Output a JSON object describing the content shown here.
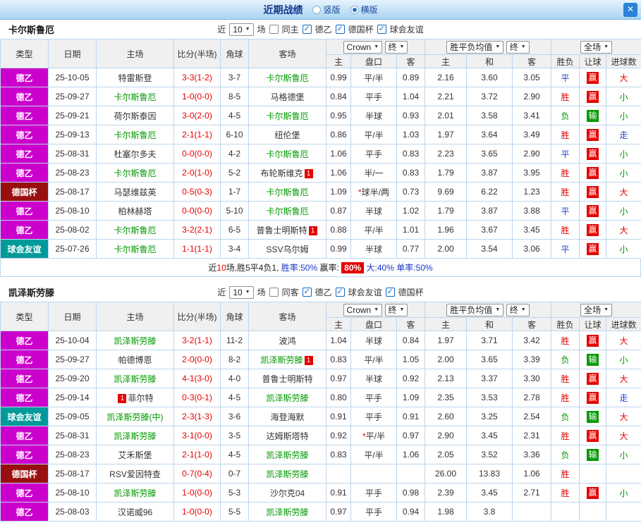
{
  "topbar": {
    "title": "近期战绩",
    "mode_vertical": "竖版",
    "mode_horizontal": "横版",
    "selected_mode": "横版",
    "close_label": "✕"
  },
  "header": {
    "type": "类型",
    "date": "日期",
    "home": "主场",
    "score": "比分(半场)",
    "corner": "角球",
    "away": "客场",
    "odds_company": "Crown",
    "odds_time": "终",
    "avg": "胜平负均值",
    "avg_time": "终",
    "scope": "全场",
    "sub_home": "主",
    "sub_handicap": "盘口",
    "sub_away": "客",
    "sub_avg_home": "主",
    "sub_avg_draw": "和",
    "sub_avg_away": "客",
    "sub_result": "胜负",
    "sub_let": "让球",
    "sub_goals": "进球数"
  },
  "colors": {
    "league2_badge": "#cc00cc",
    "cup_badge": "#990f0f",
    "friendly_badge": "#009a9a",
    "team_highlight": "#009900",
    "win_red": "#e60000",
    "draw_blue": "#2244cc",
    "lose_green": "#009900"
  },
  "sections": [
    {
      "team": "卡尔斯鲁厄",
      "filter": {
        "near": "近",
        "count": "10",
        "unit": "场",
        "same": "同主",
        "leagues": [
          "德乙",
          "德国杯",
          "球会友谊"
        ]
      },
      "rows": [
        {
          "type": "德乙",
          "date": "25-10-05",
          "home": "特雷斯登",
          "score": "3-3(1-2)",
          "corner": "3-7",
          "away": "卡尔斯鲁厄",
          "o1": "0.99",
          "pan": "平/半",
          "o2": "0.89",
          "m1": "2.16",
          "m2": "3.60",
          "m3": "3.05",
          "res": "平",
          "let": "赢",
          "goal": "大"
        },
        {
          "type": "德乙",
          "date": "25-09-27",
          "home": "卡尔斯鲁厄",
          "score": "1-0(0-0)",
          "corner": "8-5",
          "away": "马格德堡",
          "o1": "0.84",
          "pan": "平手",
          "o2": "1.04",
          "m1": "2.21",
          "m2": "3.72",
          "m3": "2.90",
          "res": "胜",
          "let": "赢",
          "goal": "小"
        },
        {
          "type": "德乙",
          "date": "25-09-21",
          "home": "荷尔斯泰因",
          "score": "3-0(2-0)",
          "corner": "4-5",
          "away": "卡尔斯鲁厄",
          "o1": "0.95",
          "pan": "半球",
          "o2": "0.93",
          "m1": "2.01",
          "m2": "3.58",
          "m3": "3.41",
          "res": "负",
          "let": "输",
          "goal": "小"
        },
        {
          "type": "德乙",
          "date": "25-09-13",
          "home": "卡尔斯鲁厄",
          "score": "2-1(1-1)",
          "corner": "6-10",
          "away": "纽伦堡",
          "o1": "0.86",
          "pan": "平/半",
          "o2": "1.03",
          "m1": "1.97",
          "m2": "3.64",
          "m3": "3.49",
          "res": "胜",
          "let": "赢",
          "goal": "走"
        },
        {
          "type": "德乙",
          "date": "25-08-31",
          "home": "杜塞尔多夫",
          "score": "0-0(0-0)",
          "corner": "4-2",
          "away": "卡尔斯鲁厄",
          "o1": "1.06",
          "pan": "平手",
          "o2": "0.83",
          "m1": "2.23",
          "m2": "3.65",
          "m3": "2.90",
          "res": "平",
          "let": "赢",
          "goal": "小"
        },
        {
          "type": "德乙",
          "date": "25-08-23",
          "home": "卡尔斯鲁厄",
          "score": "2-0(1-0)",
          "corner": "5-2",
          "away": "布轮斯维克",
          "away_rc": "1",
          "o1": "1.06",
          "pan": "半/一",
          "o2": "0.83",
          "m1": "1.79",
          "m2": "3.87",
          "m3": "3.95",
          "res": "胜",
          "let": "赢",
          "goal": "小"
        },
        {
          "type": "德国杯",
          "date": "25-08-17",
          "home": "马瑟维兹英",
          "score": "0-5(0-3)",
          "corner": "1-7",
          "away": "卡尔斯鲁厄",
          "o1": "1.09",
          "pan": "*球半/两",
          "o2": "0.73",
          "m1": "9.69",
          "m2": "6.22",
          "m3": "1.23",
          "res": "胜",
          "let": "赢",
          "goal": "大"
        },
        {
          "type": "德乙",
          "date": "25-08-10",
          "home": "柏林赫塔",
          "score": "0-0(0-0)",
          "corner": "5-10",
          "away": "卡尔斯鲁厄",
          "o1": "0.87",
          "pan": "半球",
          "o2": "1.02",
          "m1": "1.79",
          "m2": "3.87",
          "m3": "3.88",
          "res": "平",
          "let": "赢",
          "goal": "小"
        },
        {
          "type": "德乙",
          "date": "25-08-02",
          "home": "卡尔斯鲁厄",
          "score": "3-2(2-1)",
          "corner": "6-5",
          "away": "普鲁士明斯特",
          "away_rc": "1",
          "o1": "0.88",
          "pan": "平/半",
          "o2": "1.01",
          "m1": "1.96",
          "m2": "3.67",
          "m3": "3.45",
          "res": "胜",
          "let": "赢",
          "goal": "大"
        },
        {
          "type": "球会友谊",
          "date": "25-07-26",
          "home": "卡尔斯鲁厄",
          "score": "1-1(1-1)",
          "corner": "3-4",
          "away": "SSV乌尔姆",
          "o1": "0.99",
          "pan": "半球",
          "o2": "0.77",
          "m1": "2.00",
          "m2": "3.54",
          "m3": "3.06",
          "res": "平",
          "let": "赢",
          "goal": "小"
        }
      ],
      "summary": {
        "near": "近",
        "count": "10",
        "mid": "场,胜5平4负1, ",
        "win_rate": "胜率:50%",
        "yield_label": "赢率:",
        "yield_value": "80%",
        "big_rate": "大:40%",
        "single_rate": "单率:50%"
      }
    },
    {
      "team": "凯泽斯劳滕",
      "filter": {
        "near": "近",
        "count": "10",
        "unit": "场",
        "same": "同客",
        "leagues": [
          "德乙",
          "球会友谊",
          "德国杯"
        ]
      },
      "rows": [
        {
          "type": "德乙",
          "date": "25-10-04",
          "home": "凯泽斯劳滕",
          "score": "3-2(1-1)",
          "corner": "11-2",
          "away": "波鸿",
          "o1": "1.04",
          "pan": "半球",
          "o2": "0.84",
          "m1": "1.97",
          "m2": "3.71",
          "m3": "3.42",
          "res": "胜",
          "let": "赢",
          "goal": "大"
        },
        {
          "type": "德乙",
          "date": "25-09-27",
          "home": "帕德博恩",
          "score": "2-0(0-0)",
          "corner": "8-2",
          "away": "凯泽斯劳滕",
          "away_rc": "1",
          "o1": "0.83",
          "pan": "平/半",
          "o2": "1.05",
          "m1": "2.00",
          "m2": "3.65",
          "m3": "3.39",
          "res": "负",
          "let": "输",
          "goal": "小"
        },
        {
          "type": "德乙",
          "date": "25-09-20",
          "home": "凯泽斯劳滕",
          "score": "4-1(3-0)",
          "corner": "4-0",
          "away": "普鲁士明斯特",
          "o1": "0.97",
          "pan": "半球",
          "o2": "0.92",
          "m1": "2.13",
          "m2": "3.37",
          "m3": "3.30",
          "res": "胜",
          "let": "赢",
          "goal": "大"
        },
        {
          "type": "德乙",
          "date": "25-09-14",
          "home": "菲尔特",
          "home_rc": "1",
          "home_rc_pos": "before",
          "score": "0-3(0-1)",
          "corner": "4-5",
          "away": "凯泽斯劳滕",
          "o1": "0.80",
          "pan": "平手",
          "o2": "1.09",
          "m1": "2.35",
          "m2": "3.53",
          "m3": "2.78",
          "res": "胜",
          "let": "赢",
          "goal": "走"
        },
        {
          "type": "球会友谊",
          "date": "25-09-05",
          "home": "凯泽斯劳滕(中)",
          "score": "2-3(1-3)",
          "corner": "3-6",
          "away": "海登海默",
          "o1": "0.91",
          "pan": "平手",
          "o2": "0.91",
          "m1": "2.60",
          "m2": "3.25",
          "m3": "2.54",
          "res": "负",
          "let": "输",
          "goal": "大"
        },
        {
          "type": "德乙",
          "date": "25-08-31",
          "home": "凯泽斯劳滕",
          "score": "3-1(0-0)",
          "corner": "3-5",
          "away": "达姆斯塔特",
          "o1": "0.92",
          "pan": "*平/半",
          "o2": "0.97",
          "m1": "2.90",
          "m2": "3.45",
          "m3": "2.31",
          "res": "胜",
          "let": "赢",
          "goal": "大"
        },
        {
          "type": "德乙",
          "date": "25-08-23",
          "home": "艾禾斯堡",
          "score": "2-1(1-0)",
          "corner": "4-5",
          "away": "凯泽斯劳滕",
          "o1": "0.83",
          "pan": "平/半",
          "o2": "1.06",
          "m1": "2.05",
          "m2": "3.52",
          "m3": "3.36",
          "res": "负",
          "let": "输",
          "goal": "小"
        },
        {
          "type": "德国杯",
          "date": "25-08-17",
          "home": "RSV爱因特查",
          "score": "0-7(0-4)",
          "corner": "0-7",
          "away": "凯泽斯劳滕",
          "o1": "",
          "pan": "",
          "o2": "",
          "m1": "26.00",
          "m2": "13.83",
          "m3": "1.06",
          "res": "胜",
          "let": "",
          "goal": ""
        },
        {
          "type": "德乙",
          "date": "25-08-10",
          "home": "凯泽斯劳滕",
          "score": "1-0(0-0)",
          "corner": "5-3",
          "away": "沙尔克04",
          "o1": "0.91",
          "pan": "平手",
          "o2": "0.98",
          "m1": "2.39",
          "m2": "3.45",
          "m3": "2.71",
          "res": "胜",
          "let": "赢",
          "goal": "小"
        },
        {
          "type": "德乙",
          "date": "25-08-03",
          "home": "汉诺威96",
          "score": "1-0(0-0)",
          "corner": "5-5",
          "away": "凯泽斯劳滕",
          "o1": "0.97",
          "pan": "平手",
          "o2": "0.94",
          "m1": "1.98",
          "m2": "3.8",
          "m3": "",
          "res": "",
          "let": "",
          "goal": ""
        }
      ]
    }
  ]
}
